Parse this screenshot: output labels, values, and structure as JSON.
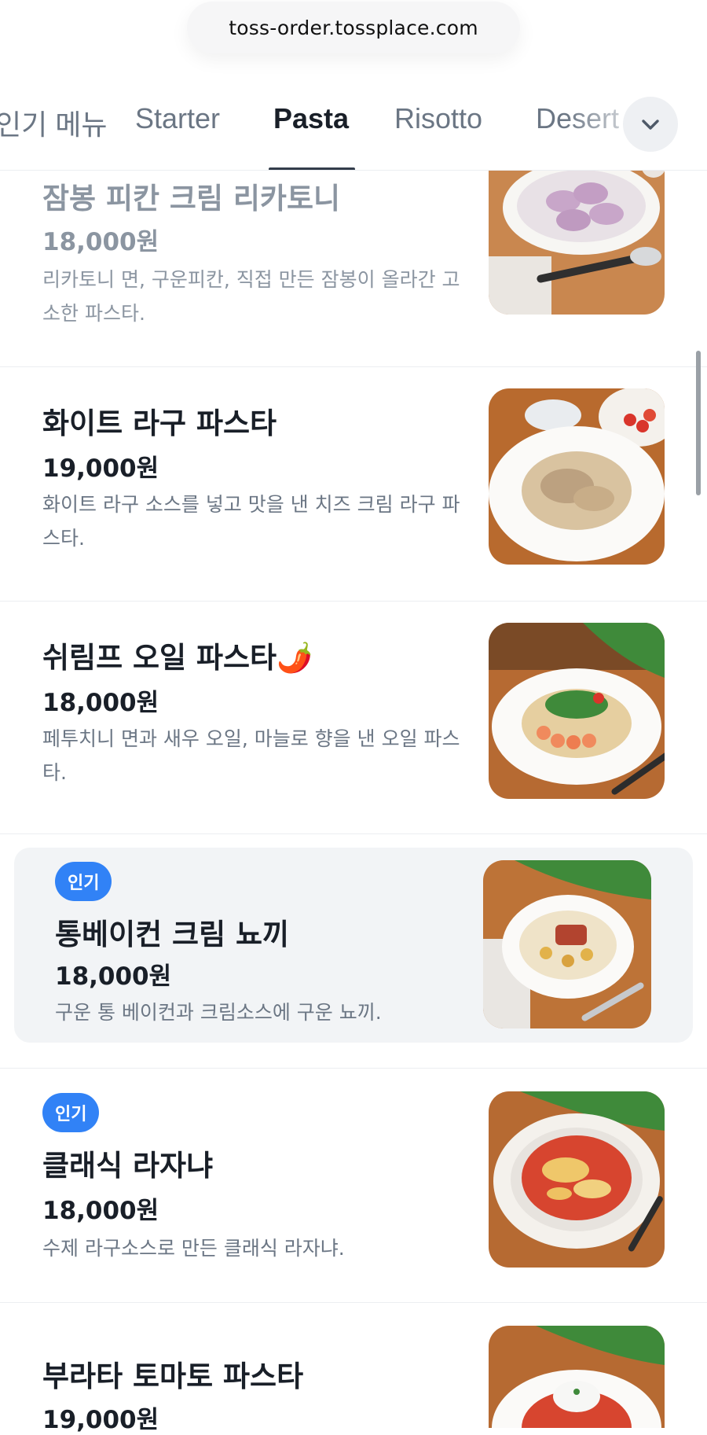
{
  "browser": {
    "url": "toss-order.tossplace.com"
  },
  "tabs": {
    "items": [
      {
        "label": "인기 메뉴"
      },
      {
        "label": "Starter"
      },
      {
        "label": "Pasta"
      },
      {
        "label": "Risotto"
      },
      {
        "label": "Desert"
      }
    ],
    "active_index": 2,
    "expand_icon": "chevron-down-icon"
  },
  "menu": {
    "items": [
      {
        "name": "잠봉 피칸 크림 리카토니",
        "price": "18,000원",
        "description": "리카토니 면, 구운피칸, 직접 만든 잠봉이 올라간 고소한 파스타.",
        "badge": ""
      },
      {
        "name": "화이트 라구 파스타",
        "price": "19,000원",
        "description": "화이트 라구 소스를 넣고 맛을 낸 치즈 크림 라구 파스타.",
        "badge": ""
      },
      {
        "name": "쉬림프 오일 파스타🌶️",
        "price": "18,000원",
        "description": "페투치니 면과 새우 오일, 마늘로 향을 낸 오일 파스타.",
        "badge": ""
      },
      {
        "name": "통베이컨 크림 뇨끼",
        "price": "18,000원",
        "description": "구운 통 베이컨과 크림소스에 구운 뇨끼.",
        "badge": "인기"
      },
      {
        "name": "클래식 라자냐",
        "price": "18,000원",
        "description": "수제 라구소스로 만든 클래식 라자냐.",
        "badge": "인기"
      },
      {
        "name": "부라타 토마토 파스타",
        "price": "19,000원",
        "description": "",
        "badge": ""
      }
    ]
  },
  "colors": {
    "accent": "#3182f6",
    "text_primary": "#191f28",
    "text_secondary": "#6b7684",
    "highlight_bg": "#f2f4f6"
  }
}
